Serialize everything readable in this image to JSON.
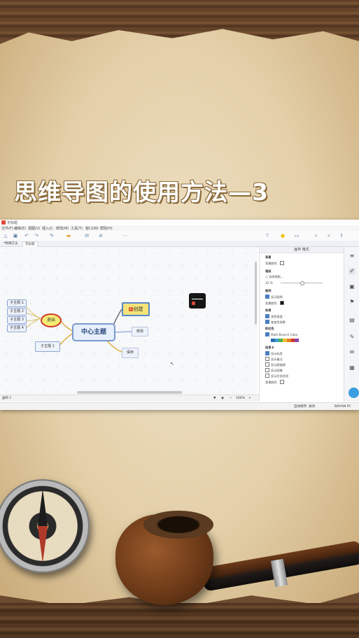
{
  "title": "思维导图的使用方法—3",
  "app": {
    "window_title": "无标题",
    "menu": [
      "文件(F)",
      "编辑(E)",
      "视图(V)",
      "插入(I)",
      "修改(M)",
      "工具(T)",
      "窗口(W)",
      "帮助(H)"
    ],
    "tabs": [
      "*畅课方法",
      "无标题"
    ],
    "mindmap": {
      "center": "中心主题",
      "exit": "退出",
      "create_number": "1",
      "create": "创建",
      "modify": "修改",
      "save": "保存",
      "subtopic": "子主题 1",
      "left_subtopics": [
        "子主题 1",
        "子主题 2",
        "子主题 3",
        "子主题 4"
      ]
    },
    "panel": {
      "header": "画布 格式",
      "sections": {
        "background": "背景",
        "background_color": "背景颜色",
        "wallpaper": "墙纸",
        "select_wallpaper": "选择墙纸...",
        "opacity_value": "32",
        "opacity_unit": "%",
        "legend": "图例",
        "show_legend": "显示图例",
        "legend_bg": "背景颜色",
        "effects": "效果",
        "gradient": "线性渐变",
        "highlight": "渐变色效果",
        "color_theme": "彩虹色",
        "multi_branch": "Multi Branch Color",
        "info_card": "信息卡",
        "show_labels": [
          "显示标签",
          "显示备注",
          "显示超链接",
          "显示图像",
          "显示任务信息"
        ],
        "bg_color2": "背景颜色"
      }
    },
    "status_left": "画布 1",
    "zoom": "100%",
    "autosave": "自动保存: 关闭",
    "brand": "BAIYAN PC",
    "colors": {
      "accent": "#4a7fc1",
      "create_bg": "#f4e47a",
      "exit_border": "#d0392b"
    },
    "icons": [
      "layout-icon",
      "brush-icon",
      "image-icon",
      "flag-icon",
      "markers-icon",
      "note-icon",
      "comment-icon",
      "task-icon"
    ]
  }
}
